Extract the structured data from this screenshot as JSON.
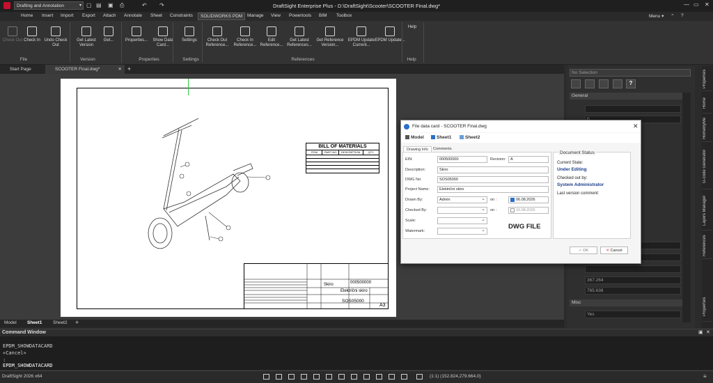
{
  "titlebar": {
    "workspace": "Drafting and Annotation",
    "title": "DraftSight Enterprise Plus - D:\\DraftSight\\Scooter\\SCOOTER Final.dwg*",
    "menu_label": "Menu",
    "help": "?"
  },
  "menus": [
    "Home",
    "Insert",
    "Import",
    "Export",
    "Attach",
    "Annotate",
    "Sheet",
    "Constraints",
    "SOLIDWORKS PDM",
    "Manage",
    "View",
    "Powertools",
    "BIM",
    "Toolbox"
  ],
  "ribbon": {
    "buttons": [
      {
        "label": "Check Out",
        "group": "File",
        "enabled": false
      },
      {
        "label": "Check In",
        "group": "File",
        "enabled": true
      },
      {
        "label": "Undo Check Out",
        "group": "File",
        "enabled": true
      },
      {
        "label": "Get Latest Version",
        "group": "Version",
        "enabled": true
      },
      {
        "label": "Get...",
        "group": "Version",
        "enabled": true
      },
      {
        "label": "Properties...",
        "group": "Properties",
        "enabled": true
      },
      {
        "label": "Show Data Card...",
        "group": "Properties",
        "enabled": true
      },
      {
        "label": "Settings",
        "group": "Settings",
        "enabled": true
      },
      {
        "label": "Check Out Reference...",
        "group": "References",
        "enabled": true
      },
      {
        "label": "Check In Reference...",
        "group": "References",
        "enabled": true
      },
      {
        "label": "Edit Reference...",
        "group": "References",
        "enabled": true
      },
      {
        "label": "Get Latest References...",
        "group": "References",
        "enabled": true
      },
      {
        "label": "Get Reference Version...",
        "group": "References",
        "enabled": true
      },
      {
        "label": "EPDM Update Current...",
        "group": "References",
        "enabled": true
      },
      {
        "label": "EPDM Update...",
        "group": "References",
        "enabled": true
      },
      {
        "label": "Help",
        "group": "Help",
        "enabled": true
      }
    ],
    "groups": [
      "File",
      "Version",
      "Properties",
      "Settings",
      "References",
      "Help"
    ]
  },
  "doc_tabs": [
    "Start Page",
    "SCOOTER Final.dwg*"
  ],
  "layout_tabs": [
    "Model",
    "Sheet1",
    "Sheet2"
  ],
  "drawing": {
    "bom_title": "BILL OF MATERIALS",
    "bom_headers": [
      "ITEM",
      "PART NO",
      "DESCRIPTION",
      "QTY"
    ],
    "tb_ein": "000500000",
    "tb_desc": "Skiro",
    "tb_project": "Električni skiro",
    "tb_dwg": "SOS05000",
    "tb_size": "A3"
  },
  "command_window": {
    "title": "Command Window",
    "lines": [
      "EPDM_SHOWDATACARD",
      "«Cancel»",
      ": ",
      "EPDM_SHOWDATACARD"
    ]
  },
  "statusbar": {
    "app": "DraftSight 2026 x64",
    "coords": "(1:1)  (152.824,279.664,0)"
  },
  "right_panel": {
    "selection": "No Selection",
    "sections": [
      "General",
      "Misc"
    ],
    "values": [
      "0",
      "367.264",
      "765.638",
      "Yes"
    ],
    "vtabs": [
      "Properties",
      "Home",
      "HomeByMe",
      "G-code Generator",
      "Layers Manager",
      "References",
      "Properties"
    ]
  },
  "dialog": {
    "title": "File data card - SCOOTER Final.dwg",
    "tabs_top": [
      "Model",
      "Sheet1",
      "Sheet2"
    ],
    "tabs": [
      "Drawing Info",
      "Comments"
    ],
    "fields": {
      "ein_label": "EIN:",
      "ein": "000500000",
      "revision_label": "Revision:",
      "revision": "A",
      "description_label": "Description:",
      "description": "Skiro",
      "dwgno_label": "DWG No:",
      "dwgno": "SOS05000",
      "project_label": "Project Name:",
      "project": "Električni skiro",
      "drawnby_label": "Drawn By:",
      "drawnby": "Admin",
      "checkedby_label": "Checked By:",
      "checkedby": "",
      "scale_label": "Scale:",
      "watermark_label": "Watermark:",
      "on_label": "on :",
      "drawn_date": "06.08.2026",
      "checked_date": "10.08.2026"
    },
    "dwg_file": "DWG FILE",
    "status": {
      "heading": "Document Status",
      "current_state_label": "Current State:",
      "current_state": "Under Editing",
      "checked_out_label": "Checked out by:",
      "checked_out": "System Administrator",
      "last_comment_label": "Last version comment:"
    },
    "ok_label": "OK",
    "cancel_label": "Cancel"
  }
}
